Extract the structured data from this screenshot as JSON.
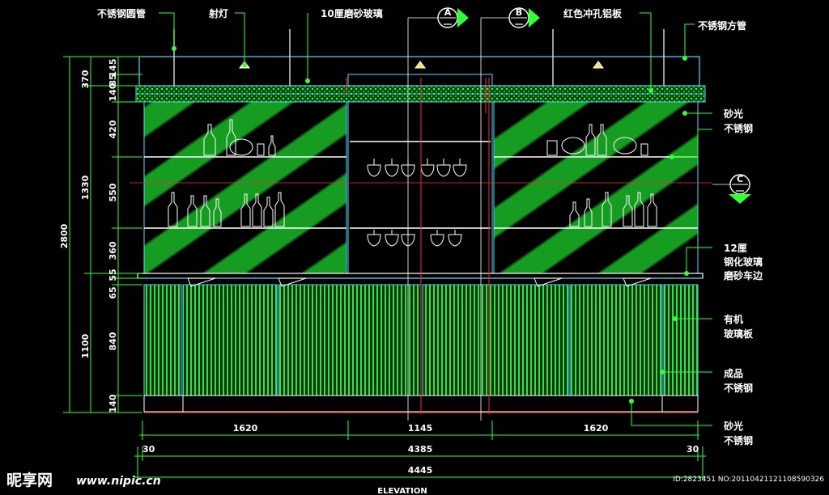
{
  "callouts_top": {
    "stainless_round_tube": "不锈钢圆管",
    "spotlight": "射灯",
    "frosted_glass": "10厘磨砂玻璃",
    "red_punched_aluminum": "红色冲孔铝板",
    "stainless_square_tube": "不锈钢方管"
  },
  "section_markers": {
    "a": "A",
    "b": "B",
    "c": "C"
  },
  "callouts_right": {
    "satin_steel_1_a": "砂光",
    "satin_steel_1_b": "不锈钢",
    "tempered_glass_a": "12厘",
    "tempered_glass_b": "钢化玻璃",
    "tempered_glass_c": "磨砂车边",
    "acrylic_a": "有机",
    "acrylic_b": "玻璃板",
    "finished_steel_a": "成品",
    "finished_steel_b": "不锈钢",
    "satin_steel_2_a": "砂光",
    "satin_steel_2_b": "不锈钢"
  },
  "dims_left_inner": [
    "145",
    "85",
    "140",
    "420",
    "550",
    "360",
    "55",
    "65",
    "840",
    "140"
  ],
  "dims_left_mid": [
    "370",
    "1330",
    "1100"
  ],
  "dims_left_outer": "2800",
  "dims_bottom_1": [
    "1620",
    "1145",
    "1620"
  ],
  "dims_bottom_2": {
    "left": "30",
    "middle": "4385",
    "right": "30"
  },
  "dims_bottom_3": "4445",
  "view_title": "ELEVATION",
  "watermark": {
    "logo": "昵享网",
    "url": "www.nipic.cn",
    "id_text": "ID:2823451 NO:20110421121108590326"
  },
  "colors": {
    "background": "#000000",
    "structure": "#4fd9ff",
    "dimension": "#35ff35",
    "green_hatch": "#1bd12b",
    "shelf_line": "#ffffff",
    "red_axis": "#ff2a2a",
    "marker": "#ffffff"
  }
}
